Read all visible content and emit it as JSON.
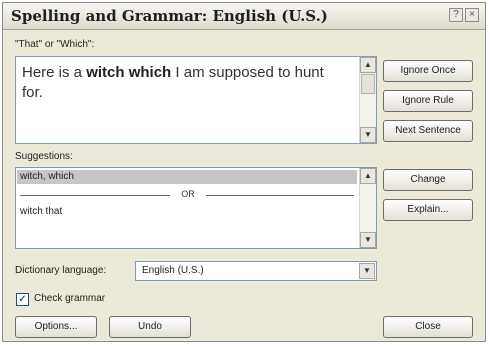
{
  "window": {
    "title": "Spelling and Grammar: English (U.S.)",
    "help_glyph": "?",
    "close_glyph": "×"
  },
  "issue": {
    "label": "\"That\" or \"Which\":",
    "sentence_before": "Here is a ",
    "sentence_error": "witch which",
    "sentence_after": " I am supposed to hunt for."
  },
  "buttons": {
    "ignore_once": "Ignore Once",
    "ignore_rule": "Ignore Rule",
    "next_sentence": "Next Sentence",
    "change": "Change",
    "explain": "Explain...",
    "options": "Options...",
    "undo": "Undo",
    "close": "Close"
  },
  "suggestions": {
    "label": "Suggestions:",
    "items": [
      "witch, which",
      "witch that"
    ],
    "separator_text": "OR",
    "selected_index": 0
  },
  "dictionary": {
    "label": "Dictionary language:",
    "value": "English (U.S.)"
  },
  "check_grammar": {
    "label": "Check grammar",
    "checked": true
  },
  "scroll_glyphs": {
    "up": "▲",
    "down": "▼"
  },
  "colors": {
    "dialog_bg": "#ece9d8",
    "field_border": "#7f9db9",
    "selection_bg": "#c6c6c6"
  }
}
